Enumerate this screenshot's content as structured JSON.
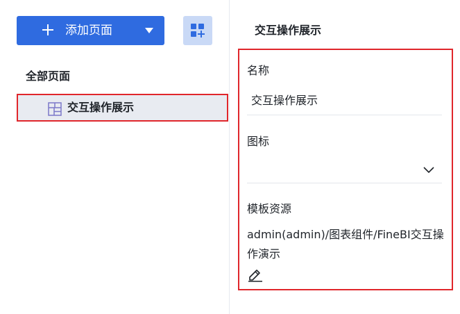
{
  "sidebar": {
    "add_page_label": "添加页面",
    "section_title": "全部页面",
    "pages": [
      {
        "label": "交互操作展示",
        "icon": "dashboard-layout-icon",
        "selected": true
      }
    ]
  },
  "panel": {
    "title": "交互操作展示",
    "name_label": "名称",
    "name_value": "交互操作展示",
    "icon_label": "图标",
    "icon_value": "",
    "template_label": "模板资源",
    "template_value": "admin(admin)/图表组件/FineBI交互操作演示"
  },
  "colors": {
    "primary": "#2f6be0",
    "secondary_button": "#c9d9f6",
    "selected_item": "#e8ebf1",
    "highlight_border": "#e0262b",
    "item_icon": "#7b78c9"
  }
}
